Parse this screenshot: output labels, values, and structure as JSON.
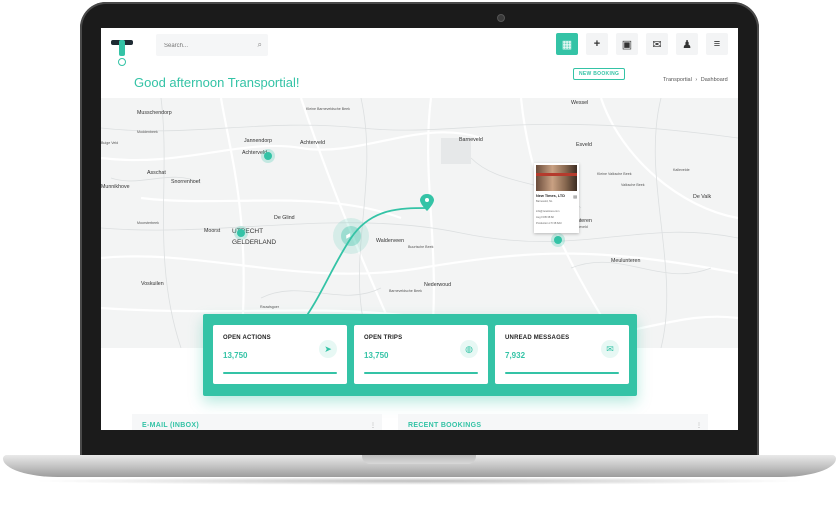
{
  "header": {
    "search_placeholder": "Search...",
    "new_booking_label": "NEW BOOKING",
    "greeting": "Good afternoon Transportial!",
    "breadcrumb": {
      "first": "Transportial",
      "separator": "›",
      "second": "Dashboard"
    }
  },
  "map": {
    "places": [
      "Wessel",
      "Musschendorp",
      "Kleine Barneveldsche Beek",
      "Moddenbeek",
      "Jannendorp",
      "Achterveld",
      "Achterveld",
      "Barneveld",
      "Esveld",
      "Buige Veld",
      "Asschat",
      "Snorrenhoef",
      "Munnikhove",
      "Kleine Valksche Beek",
      "Valksche Beek",
      "De Valk",
      "Kallevelde",
      "Moorsterbeek",
      "De Glind",
      "Moorst",
      "UTRECHT",
      "GELDERLAND",
      "Walderveen",
      "Buurtsche Beek",
      "Meulunteren",
      "Voskuilen",
      "Nederwoud",
      "Barneveldsche Beek",
      "Rauwlsgoer",
      "Lunteren",
      "Kalteveld"
    ],
    "popup": {
      "name": "New Times, LTD",
      "line1": "Barneveld, NL",
      "line2": "info@newtimes.com",
      "line3": "Aug FOB 38 82",
      "line4": "Production LTI 38 8A3"
    }
  },
  "stats": [
    {
      "title": "OPEN ACTIONS",
      "value": "13,750",
      "icon": "send-icon"
    },
    {
      "title": "OPEN TRIPS",
      "value": "13,750",
      "icon": "globe-icon"
    },
    {
      "title": "UNREAD MESSAGES",
      "value": "7,932",
      "icon": "mail-icon"
    }
  ],
  "panels": {
    "left_title": "E-MAIL (INBOX)",
    "right_title": "RECENT BOOKINGS",
    "menu": "⋮"
  },
  "colors": {
    "accent": "#34c3a6",
    "dark": "#1e2b33"
  }
}
